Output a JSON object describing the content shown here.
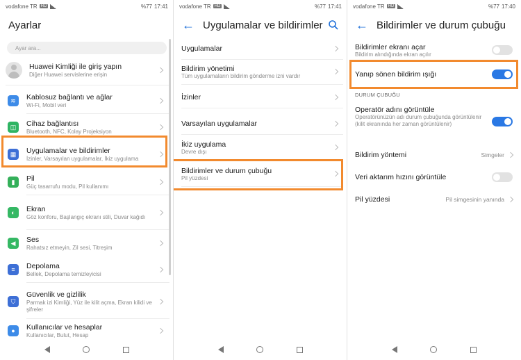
{
  "status": {
    "carrier": "vodafone TR",
    "volte": "HD",
    "battery": "%77",
    "time_p1": "17:41",
    "time_p2": "17:41",
    "time_p3": "17:40"
  },
  "panel1": {
    "title": "Ayarlar",
    "search_placeholder": "Ayar ara...",
    "account": {
      "title": "Huawei Kimliği ile giriş yapın",
      "subtitle": "Diğer Huawei servislerine erişin"
    },
    "items": [
      {
        "title": "Kablosuz bağlantı ve ağlar",
        "subtitle": "Wi-Fi, Mobil veri",
        "icon": "wifi-icon",
        "color": "#3d8be8",
        "glyph": "≋"
      },
      {
        "title": "Cihaz bağlantısı",
        "subtitle": "Bluetooth, NFC, Kolay Projeksiyon",
        "icon": "device-connection-icon",
        "color": "#2fb463",
        "glyph": "◫"
      },
      {
        "title": "Uygulamalar ve bildirimler",
        "subtitle": "İzinler, Varsayılan uygulamalar, İkiz uygulama",
        "icon": "apps-icon",
        "color": "#3d6fd6",
        "glyph": "▦"
      },
      {
        "title": "Pil",
        "subtitle": "Güç tasarrufu modu, Pil kullanımı",
        "icon": "battery-icon",
        "color": "#34b05a",
        "glyph": "▮"
      },
      {
        "title": "Ekran",
        "subtitle": "Göz konforu, Başlangıç ekranı stili, Duvar kağıdı",
        "icon": "display-icon",
        "color": "#35b864",
        "glyph": "◐"
      },
      {
        "title": "Ses",
        "subtitle": "Rahatsız etmeyin, Zil sesi, Titreşim",
        "icon": "sound-icon",
        "color": "#35b864",
        "glyph": "◀"
      },
      {
        "title": "Depolama",
        "subtitle": "Bellek, Depolama temizleyicisi",
        "icon": "storage-icon",
        "color": "#3d6fd6",
        "glyph": "≡"
      },
      {
        "title": "Güvenlik ve gizlilik",
        "subtitle": "Parmak izi Kimliği, Yüz ile kilit açma, Ekran kilidi ve şifreler",
        "icon": "security-icon",
        "color": "#3d6fd6",
        "glyph": "⛉"
      },
      {
        "title": "Kullanıcılar ve hesaplar",
        "subtitle": "Kullanıcılar, Bulut, Hesap",
        "icon": "users-icon",
        "color": "#3d8be8",
        "glyph": "●"
      }
    ]
  },
  "panel2": {
    "title": "Uygulamalar ve bildirimler",
    "items": [
      {
        "title": "Uygulamalar",
        "subtitle": ""
      },
      {
        "title": "Bildirim yönetimi",
        "subtitle": "Tüm uygulamaların bildirim gönderme izni vardır"
      },
      {
        "title": "İzinler",
        "subtitle": ""
      },
      {
        "title": "Varsayılan uygulamalar",
        "subtitle": ""
      },
      {
        "title": "İkiz uygulama",
        "subtitle": "Devre dışı"
      },
      {
        "title": "Bildirimler ve durum çubuğu",
        "subtitle": "Pil yüzdesi"
      }
    ]
  },
  "panel3": {
    "title": "Bildirimler ve durum çubuğu",
    "items": [
      {
        "title": "Bildirimler ekranı açar",
        "subtitle": "Bildirim alındığında ekran açılır",
        "toggle": false
      },
      {
        "title": "Yanıp sönen bildirim ışığı",
        "subtitle": "",
        "toggle": true
      }
    ],
    "section_label": "DURUM ÇUBUĞU",
    "status_items": [
      {
        "title": "Operatör adını görüntüle",
        "subtitle": "Operatörünüzün adı durum çubuğunda görüntülenir (kilit ekranında her zaman görüntülenir)",
        "toggle": true
      },
      {
        "title": "Bildirim yöntemi",
        "value": "Simgeler"
      },
      {
        "title": "Veri aktarım hızını görüntüle",
        "toggle": false
      },
      {
        "title": "Pil yüzdesi",
        "value": "Pil simgesinin yanında"
      }
    ]
  },
  "colors": {
    "accent": "#2a78e4",
    "highlight": "#f28a2e"
  }
}
